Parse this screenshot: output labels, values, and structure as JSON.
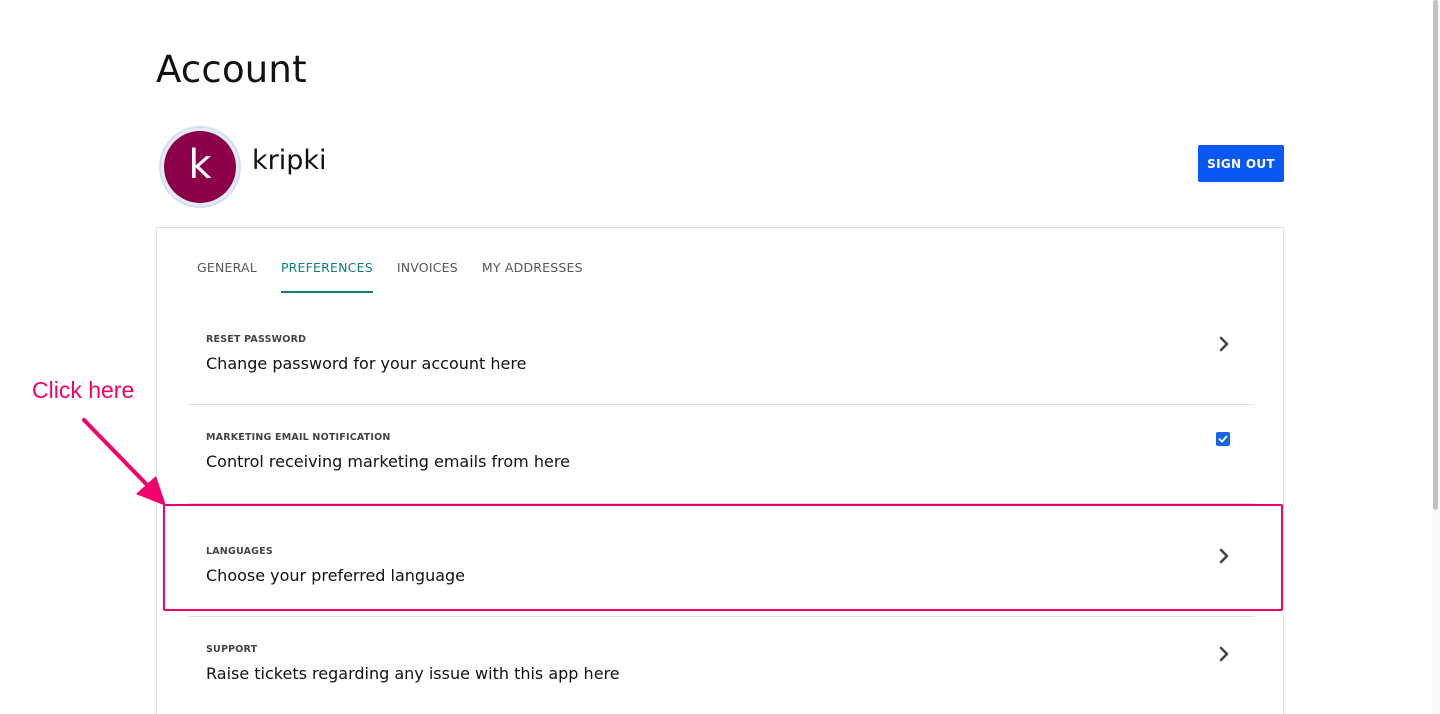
{
  "page": {
    "title": "Account"
  },
  "profile": {
    "avatar_letter": "k",
    "username": "kripki",
    "avatar_color": "#8c0049"
  },
  "actions": {
    "sign_out_label": "SIGN OUT"
  },
  "tabs": [
    {
      "label": "GENERAL",
      "active": false
    },
    {
      "label": "PREFERENCES",
      "active": true
    },
    {
      "label": "INVOICES",
      "active": false
    },
    {
      "label": "MY ADDRESSES",
      "active": false
    }
  ],
  "settings": [
    {
      "label": "RESET PASSWORD",
      "description": "Change password for your account here",
      "control": "chevron-right-icon"
    },
    {
      "label": "MARKETING EMAIL NOTIFICATION",
      "description": "Control receiving marketing emails from here",
      "control": "checkbox",
      "checked": true
    },
    {
      "label": "LANGUAGES",
      "description": "Choose your preferred language",
      "control": "chevron-right-icon"
    },
    {
      "label": "SUPPORT",
      "description": "Raise tickets regarding any issue with this app here",
      "control": "chevron-right-icon"
    }
  ],
  "annotation": {
    "text": "Click here",
    "color": "#f2006c"
  },
  "colors": {
    "primary": "#0b57f5",
    "active_tab": "#0f7f7a"
  }
}
